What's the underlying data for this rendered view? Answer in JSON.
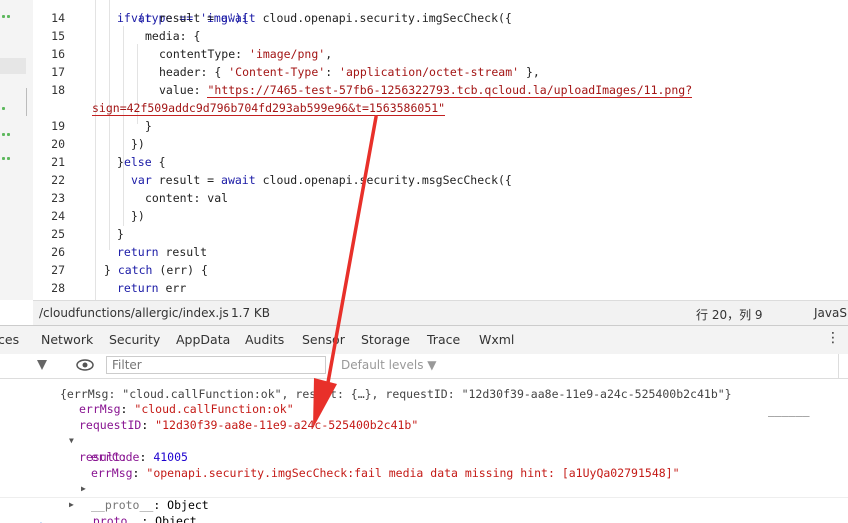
{
  "editor": {
    "lines": [
      {
        "n": "14",
        "code": [
          [
            "kw",
            "var"
          ],
          [
            "",
            "result = "
          ],
          [
            "kw",
            "await"
          ],
          [
            "",
            "cloud.openapi.security.imgSecCheck({"
          ]
        ]
      },
      {
        "n": "15",
        "code": [
          [
            "",
            "media: {"
          ]
        ]
      },
      {
        "n": "16",
        "code": [
          [
            "",
            "contentType: "
          ],
          [
            "str",
            "'image/png'"
          ],
          [
            "",
            ","
          ]
        ]
      },
      {
        "n": "17",
        "code": [
          [
            "",
            "header: { "
          ],
          [
            "str",
            "'Content-Type'"
          ],
          [
            "",
            ": "
          ],
          [
            "str",
            "'application/octet-stream'"
          ],
          [
            "",
            " },"
          ]
        ]
      },
      {
        "n": "18",
        "code": [
          [
            "",
            "value: "
          ],
          [
            "str",
            "\"https://7465-test-57fb6-1256322793.tcb.qcloud.la/uploadImages/11.png?"
          ]
        ]
      },
      {
        "n": "",
        "code": [
          [
            "str",
            "sign=42f509addc9d796b704fd293ab599e96&t=1563586051\""
          ]
        ]
      },
      {
        "n": "19",
        "code": [
          [
            "",
            "}"
          ]
        ]
      },
      {
        "n": "20",
        "code": [
          [
            "",
            "})"
          ]
        ]
      },
      {
        "n": "21",
        "code": [
          [
            "",
            "}"
          ],
          [
            "kw",
            "else"
          ],
          [
            "",
            "{"
          ]
        ]
      },
      {
        "n": "22",
        "code": [
          [
            "kw",
            "var"
          ],
          [
            "",
            "result = "
          ],
          [
            "kw",
            "await"
          ],
          [
            "",
            "cloud.openapi.security.msgSecCheck({"
          ]
        ]
      },
      {
        "n": "23",
        "code": [
          [
            "",
            "content: val"
          ]
        ]
      },
      {
        "n": "24",
        "code": [
          [
            "",
            "})"
          ]
        ]
      },
      {
        "n": "25",
        "code": [
          [
            "",
            "}"
          ]
        ]
      },
      {
        "n": "26",
        "code": [
          [
            "kw",
            "return"
          ],
          [
            "",
            " result"
          ]
        ]
      },
      {
        "n": "27",
        "code": [
          [
            "",
            "} "
          ],
          [
            "kw",
            "catch"
          ],
          [
            "",
            " (err) {"
          ]
        ]
      },
      {
        "n": "28",
        "code": [
          [
            "kw",
            "return"
          ],
          [
            "",
            " err"
          ]
        ]
      }
    ],
    "top_partial": "if (type == 'img'){"
  },
  "status": {
    "path": "/cloudfunctions/allergic/index.js",
    "size": "1.7 KB",
    "position": "行 20，列 9",
    "lang": "JavaS"
  },
  "tabs": [
    "ces",
    "Network",
    "Security",
    "AppData",
    "Audits",
    "Sensor",
    "Storage",
    "Trace",
    "Wxml"
  ],
  "filter": {
    "placeholder": "Filter",
    "levels": "Default levels ▼"
  },
  "console": {
    "top_cut": "{errMsg: \"cloud.callFunction:ok\", result: {…}, requestID: \"12d30f39-aa8e-11e9-a24c-525400b2c41b\"}",
    "errMsg_key": "errMsg",
    "errMsg_val": "\"cloud.callFunction:ok\"",
    "requestID_key": "requestID",
    "requestID_val": "\"12d30f39-aa8e-11e9-a24c-525400b2c41b\"",
    "result_key": "result:",
    "errCode_key": "errCode",
    "errCode_val": "41005",
    "errMsg2_key": "errMsg",
    "errMsg2_val": "\"openapi.security.imgSecCheck:fail media data missing hint: [a1UyQa02791548]\"",
    "proto_inner": "__proto__",
    "proto_outer": "__proto__",
    "object_label": "Object",
    "prompt": ">"
  },
  "colors": {
    "arrow": "#e8302a",
    "underline": "#c32020"
  }
}
